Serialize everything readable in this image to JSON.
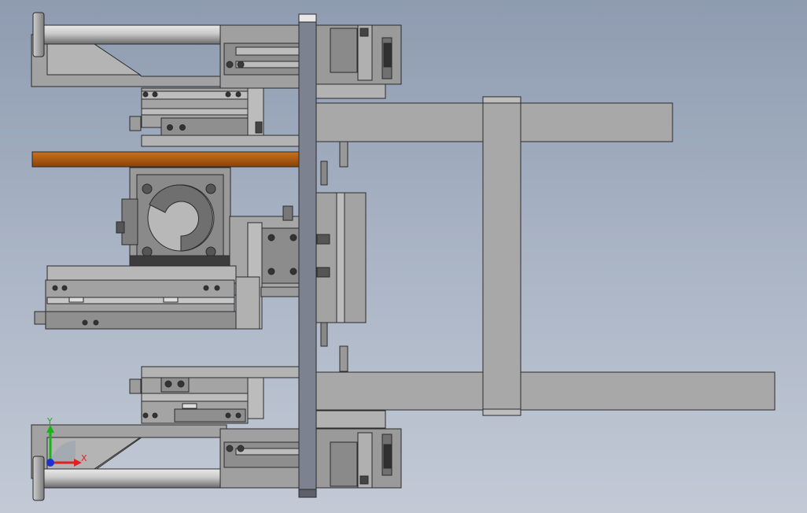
{
  "viewport": {
    "background_top": "#8e9bb0",
    "background_bottom": "#c3cad6"
  },
  "model": {
    "part_color": "#a9a9a9",
    "dark_part_color": "#6f6f6f",
    "plate_color": "#7e8390",
    "bar_color": "#b05a14",
    "icons": [
      "axis-triad-icon"
    ]
  },
  "triad": {
    "y_label": "Y",
    "x_label": "X",
    "y_color": "#17b317",
    "x_color": "#e02020",
    "z_color": "#2030d0"
  }
}
